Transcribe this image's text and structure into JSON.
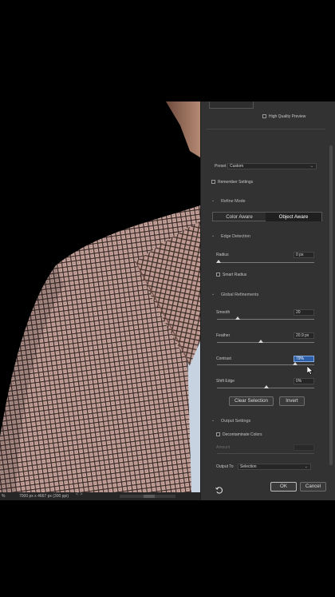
{
  "panel": {
    "high_quality_preview": "High Quality Preview",
    "preset_label": "Preset",
    "preset_value": "Custom",
    "remember_settings": "Remember Settings",
    "refine_mode": {
      "heading": "Refine Mode",
      "options": [
        "Color Aware",
        "Object Aware"
      ],
      "selected": "Object Aware"
    },
    "edge_detection": {
      "heading": "Edge Detection",
      "radius_label": "Radius",
      "radius_value": "0 px",
      "smart_radius": "Smart Radius"
    },
    "global_refinements": {
      "heading": "Global Refinements",
      "smooth_label": "Smooth",
      "smooth_value": "20",
      "feather_label": "Feather",
      "feather_value": "20.9 px",
      "contrast_label": "Contrast",
      "contrast_value": "79%",
      "shift_edge_label": "Shift Edge",
      "shift_edge_value": "0%"
    },
    "clear_selection": "Clear Selection",
    "invert": "Invert",
    "output_settings": {
      "heading": "Output Settings",
      "decontaminate": "Decontaminate Colors",
      "amount_label": "Amount",
      "output_to_label": "Output To",
      "output_to_value": "Selection"
    },
    "ok": "OK",
    "cancel": "Cancel"
  },
  "status": {
    "zoom": "%",
    "doc_info": "7000 px x 4667 px (300 ppi)",
    "nav": "<  >"
  },
  "colors": {
    "panel_bg": "#323232",
    "field_bg": "#262626",
    "active_field": "#2c5fa8",
    "jacket": "#c9a9a0"
  }
}
